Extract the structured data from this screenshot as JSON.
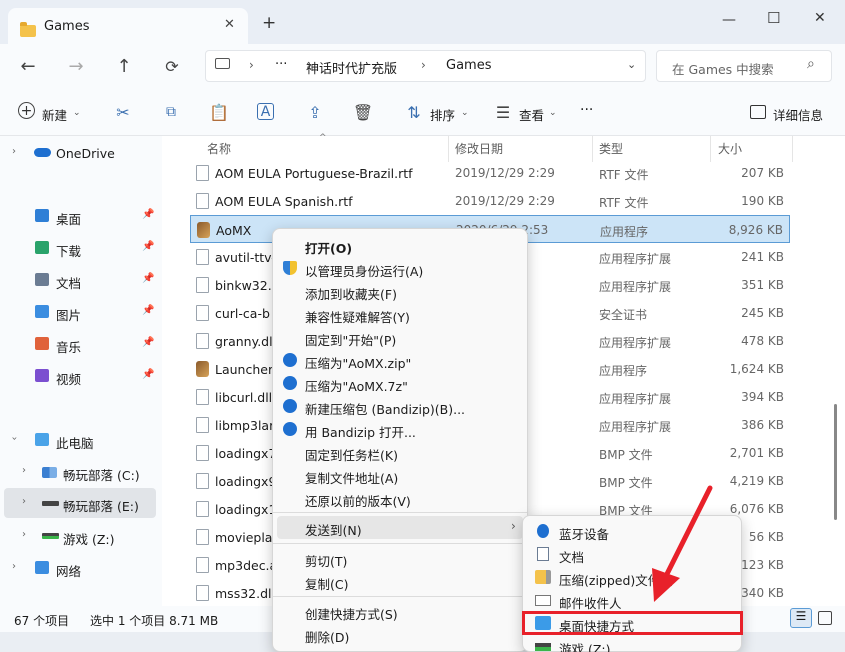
{
  "window": {
    "tab_title": "Games",
    "new_tab": "+",
    "min": "—",
    "max": "☐",
    "close": "✕"
  },
  "address": {
    "more": "···",
    "path": [
      "神话时代扩充版",
      "Games"
    ],
    "sep": "›",
    "search_placeholder": "在 Games 中搜索"
  },
  "toolbar": {
    "new": "新建",
    "sort": "排序",
    "view": "查看",
    "more": "···",
    "details": "详细信息"
  },
  "sidebar": {
    "onedrive": "OneDrive",
    "quick": [
      {
        "label": "桌面",
        "color": "#2f7fd6"
      },
      {
        "label": "下载",
        "color": "#2aa36b"
      },
      {
        "label": "文档",
        "color": "#6b7c93"
      },
      {
        "label": "图片",
        "color": "#3b8de0"
      },
      {
        "label": "音乐",
        "color": "#e0623b"
      },
      {
        "label": "视频",
        "color": "#7b4fd0"
      }
    ],
    "this_pc": "此电脑",
    "drives": [
      "畅玩部落 (C:)",
      "畅玩部落 (E:)",
      "游戏 (Z:)"
    ],
    "network": "网络"
  },
  "columns": {
    "name": "名称",
    "date": "修改日期",
    "type": "类型",
    "size": "大小"
  },
  "files": [
    {
      "name": "AOM EULA Portuguese-Brazil.rtf",
      "date": "2019/12/29 2:29",
      "type": "RTF 文件",
      "size": "207 KB"
    },
    {
      "name": "AOM EULA Spanish.rtf",
      "date": "2019/12/29 2:29",
      "type": "RTF 文件",
      "size": "190 KB"
    },
    {
      "name": "AoMX",
      "date": "2020/6/29 2:53",
      "type": "应用程序",
      "size": "8,926 KB"
    },
    {
      "name": "avutil-ttv-",
      "date": "2:29",
      "type": "应用程序扩展",
      "size": "241 KB"
    },
    {
      "name": "binkw32.",
      "date": "2:29",
      "type": "应用程序扩展",
      "size": "351 KB"
    },
    {
      "name": "curl-ca-b",
      "date": "2:29",
      "type": "安全证书",
      "size": "245 KB"
    },
    {
      "name": "granny.dl",
      "date": "2:29",
      "type": "应用程序扩展",
      "size": "478 KB"
    },
    {
      "name": "Launcher",
      "date": "2:12",
      "type": "应用程序",
      "size": "1,624 KB"
    },
    {
      "name": "libcurl.dll",
      "date": "53",
      "type": "应用程序扩展",
      "size": "394 KB"
    },
    {
      "name": "libmp3lar",
      "date": "2:29",
      "type": "应用程序扩展",
      "size": "386 KB"
    },
    {
      "name": "loadingx7",
      "date": "2:29",
      "type": "BMP 文件",
      "size": "2,701 KB"
    },
    {
      "name": "loadingx9",
      "date": "2:29",
      "type": "BMP 文件",
      "size": "4,219 KB"
    },
    {
      "name": "loadingx1",
      "date": "2:29",
      "type": "BMP 文件",
      "size": "6,076 KB"
    },
    {
      "name": "moviepla",
      "date": "",
      "type": "",
      "size": "56 KB"
    },
    {
      "name": "mp3dec.a",
      "date": "",
      "type": "",
      "size": "123 KB"
    },
    {
      "name": "mss32.dll",
      "date": "",
      "type": "",
      "size": "340 KB"
    }
  ],
  "status": {
    "count": "67 个项目",
    "selected": "选中 1 个项目  8.71 MB"
  },
  "context_menu": [
    {
      "label": "打开(O)",
      "bold": true
    },
    {
      "label": "以管理员身份运行(A)"
    },
    {
      "label": "添加到收藏夹(F)"
    },
    {
      "label": "兼容性疑难解答(Y)"
    },
    {
      "label": "固定到\"开始\"(P)"
    },
    {
      "label": "压缩为\"AoMX.zip\""
    },
    {
      "label": "压缩为\"AoMX.7z\""
    },
    {
      "label": "新建压缩包 (Bandizip)(B)..."
    },
    {
      "label": "用 Bandizip 打开..."
    },
    {
      "label": "固定到任务栏(K)"
    },
    {
      "label": "复制文件地址(A)"
    },
    {
      "label": "还原以前的版本(V)"
    },
    {
      "label": "发送到(N)"
    },
    {
      "label": "剪切(T)"
    },
    {
      "label": "复制(C)"
    },
    {
      "label": "创建快捷方式(S)"
    },
    {
      "label": "删除(D)"
    }
  ],
  "submenu": [
    "蓝牙设备",
    "文档",
    "压缩(zipped)文件夹",
    "邮件收件人",
    "桌面快捷方式",
    "游戏 (Z:)"
  ],
  "colors": {
    "accent": "#0067c0",
    "highlight": "#e8212a",
    "selection": "#cce4f7"
  }
}
